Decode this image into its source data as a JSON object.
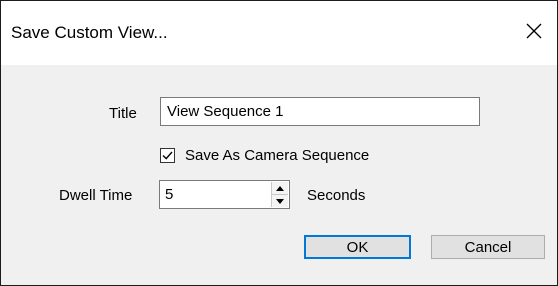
{
  "window": {
    "title": "Save Custom View...",
    "close_icon": "close-icon"
  },
  "form": {
    "title_label": "Title",
    "title_value": "View Sequence 1",
    "save_as_sequence_label": "Save As Camera Sequence",
    "save_as_sequence_checked": true,
    "dwell_label": "Dwell Time",
    "dwell_value": "5",
    "dwell_unit": "Seconds"
  },
  "buttons": {
    "ok": "OK",
    "cancel": "Cancel"
  },
  "colors": {
    "dialog_bg": "#f0f0f0",
    "titlebar_bg": "#ffffff",
    "default_button_border": "#0078d7"
  }
}
